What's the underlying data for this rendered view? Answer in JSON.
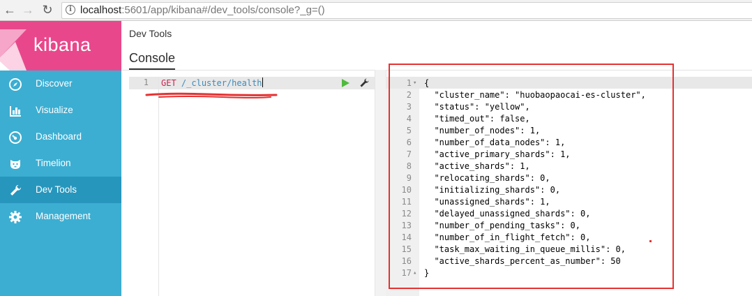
{
  "browser": {
    "back": "←",
    "forward": "→",
    "reload": "↻",
    "url_host": "localhost",
    "url_rest": ":5601/app/kibana#/dev_tools/console?_g=()"
  },
  "sidebar": {
    "logo_text": "kibana",
    "items": [
      {
        "label": "Discover",
        "icon": "compass-icon"
      },
      {
        "label": "Visualize",
        "icon": "bar-chart-icon"
      },
      {
        "label": "Dashboard",
        "icon": "dashboard-icon"
      },
      {
        "label": "Timelion",
        "icon": "timelion-icon"
      },
      {
        "label": "Dev Tools",
        "icon": "wrench-icon",
        "active": true
      },
      {
        "label": "Management",
        "icon": "gear-icon"
      }
    ]
  },
  "header": {
    "breadcrumb": "Dev Tools",
    "tab": "Console"
  },
  "editor": {
    "line_number": "1",
    "method": "GET",
    "path": "/_cluster/health"
  },
  "output": {
    "lines": [
      {
        "n": "1",
        "fold": "▾",
        "text": "{"
      },
      {
        "n": "2",
        "text": "  \"cluster_name\": \"huobaopaocai-es-cluster\","
      },
      {
        "n": "3",
        "text": "  \"status\": \"yellow\","
      },
      {
        "n": "4",
        "text": "  \"timed_out\": false,"
      },
      {
        "n": "5",
        "text": "  \"number_of_nodes\": 1,"
      },
      {
        "n": "6",
        "text": "  \"number_of_data_nodes\": 1,"
      },
      {
        "n": "7",
        "text": "  \"active_primary_shards\": 1,"
      },
      {
        "n": "8",
        "text": "  \"active_shards\": 1,"
      },
      {
        "n": "9",
        "text": "  \"relocating_shards\": 0,"
      },
      {
        "n": "10",
        "text": "  \"initializing_shards\": 0,"
      },
      {
        "n": "11",
        "text": "  \"unassigned_shards\": 1,"
      },
      {
        "n": "12",
        "text": "  \"delayed_unassigned_shards\": 0,"
      },
      {
        "n": "13",
        "text": "  \"number_of_pending_tasks\": 0,"
      },
      {
        "n": "14",
        "text": "  \"number_of_in_flight_fetch\": 0,"
      },
      {
        "n": "15",
        "text": "  \"task_max_waiting_in_queue_millis\": 0,"
      },
      {
        "n": "16",
        "text": "  \"active_shards_percent_as_number\": 50"
      },
      {
        "n": "17",
        "fold": "▴",
        "text": "}"
      }
    ]
  },
  "colors": {
    "sidebar": "#3caed2",
    "sidebar_active": "#2796bd",
    "logo": "#e8488b",
    "annotation": "#e53232"
  }
}
